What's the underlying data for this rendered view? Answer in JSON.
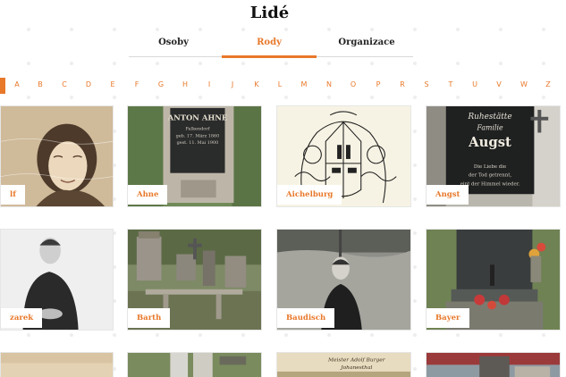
{
  "page": {
    "title": "Lidé"
  },
  "tabs": [
    {
      "label": "Osoby",
      "active": false
    },
    {
      "label": "Rody",
      "active": true
    },
    {
      "label": "Organizace",
      "active": false
    }
  ],
  "alphabet": [
    "A",
    "B",
    "C",
    "D",
    "E",
    "F",
    "G",
    "H",
    "I",
    "J",
    "K",
    "L",
    "M",
    "N",
    "O",
    "P",
    "R",
    "S",
    "T",
    "U",
    "V",
    "W",
    "Z"
  ],
  "cards": [
    {
      "label": "lf"
    },
    {
      "label": "Ahne"
    },
    {
      "label": "Aichelburg"
    },
    {
      "label": "Angst"
    },
    {
      "label": "zarek"
    },
    {
      "label": "Barth"
    },
    {
      "label": "Baudisch"
    },
    {
      "label": "Bayer"
    }
  ],
  "image_text": {
    "ahne_line1": "ANTON AHNE",
    "ahne_line2": "Falkendorf",
    "ahne_line3": "geb. 17. März 1860",
    "ahne_line4": "gest. 11. Mai 1900",
    "angst_line1": "Ruhestätte",
    "angst_line2": "Familie",
    "angst_line3": "Augst",
    "angst_line4": "Die Liebe die",
    "angst_line5": "der Tod getrennt,",
    "angst_line6": "eint der Himmel wieder.",
    "postcard_line1": "Meister Adolf Burger",
    "postcard_line2": "Johanesthal"
  },
  "colors": {
    "accent": "#e8782a",
    "text": "#222222",
    "label_bg": "#ffffff"
  }
}
